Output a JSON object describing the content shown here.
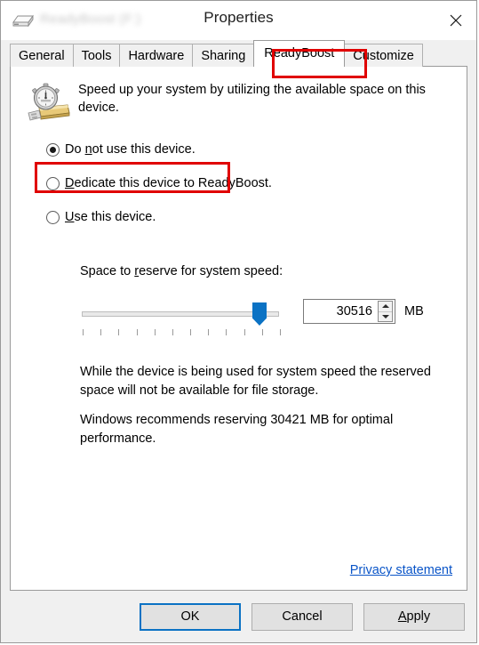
{
  "window": {
    "title": "Properties",
    "title_blurred_prefix": "ReadyBoost (F:)",
    "drive_icon": "hard-drive-icon",
    "close_icon": "close-icon"
  },
  "tabs": {
    "items": [
      {
        "label": "General",
        "active": false
      },
      {
        "label": "Tools",
        "active": false
      },
      {
        "label": "Hardware",
        "active": false
      },
      {
        "label": "Sharing",
        "active": false
      },
      {
        "label": "ReadyBoost",
        "active": true
      },
      {
        "label": "Customize",
        "active": false
      }
    ],
    "active_label": "ReadyBoost"
  },
  "panel": {
    "icon": "readyboost-stopwatch-usb-icon",
    "description": "Speed up your system by utilizing the available space on this device.",
    "radios": [
      {
        "id": "do-not-use",
        "label_before": "Do ",
        "accel": "n",
        "label_after": "ot use this device.",
        "checked": true
      },
      {
        "id": "dedicate",
        "label_before": "",
        "accel": "D",
        "label_after": "edicate this device to ReadyBoost.",
        "checked": false
      },
      {
        "id": "use-this-device",
        "label_before": "",
        "accel": "U",
        "label_after": "se this device.",
        "checked": false
      }
    ],
    "reserve": {
      "label_before": "Space to ",
      "accel": "r",
      "label_after": "eserve for system speed:",
      "slider": {
        "value": 30516,
        "min": 0,
        "max": 31000,
        "percent": 93,
        "tick_count": 12
      },
      "spin_value": "30516",
      "unit": "MB"
    },
    "notes": [
      "While the device is being used for system speed the reserved space will not be available for file storage.",
      "Windows recommends reserving 30421 MB for optimal performance."
    ],
    "recommended_mb": "30421",
    "privacy_link": "Privacy statement"
  },
  "footer": {
    "ok": "OK",
    "cancel": "Cancel",
    "apply_accel": "A",
    "apply_rest": "pply"
  },
  "colors": {
    "accent_blue": "#0b72c4",
    "link_blue": "#0a55c8",
    "annotation_red": "#e00000",
    "panel_bg": "#ffffff",
    "chrome_bg": "#f0f0f0"
  }
}
